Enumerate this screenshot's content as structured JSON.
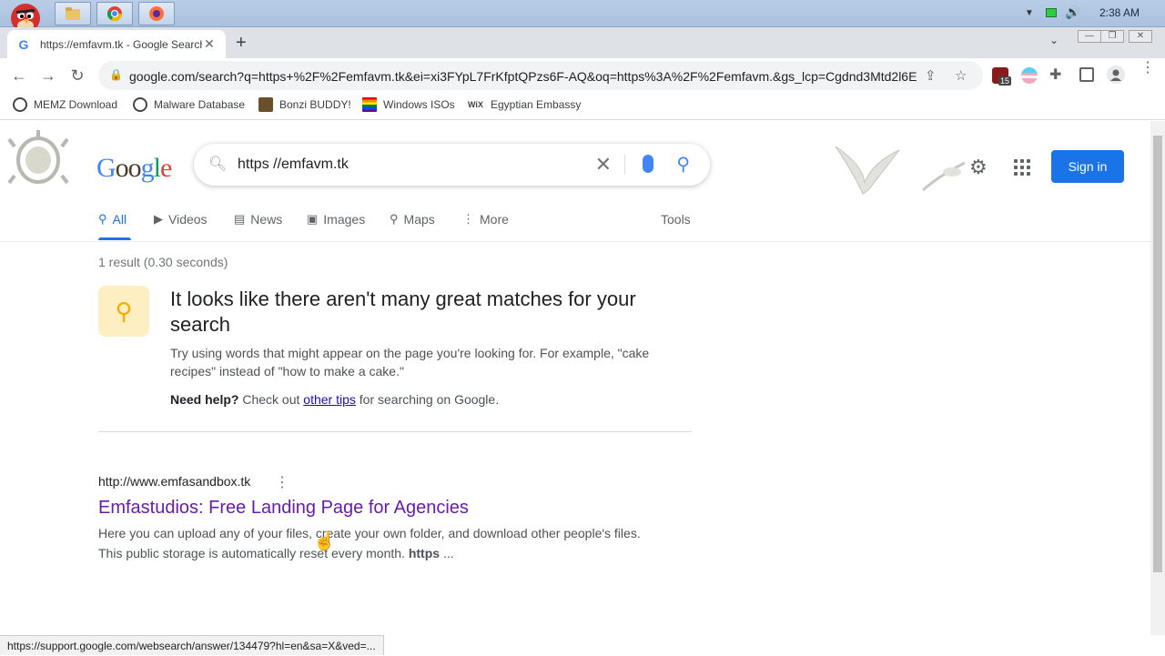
{
  "taskbar": {
    "time": "2:38 AM",
    "apps": [
      "angry-birds-icon",
      "folder-icon",
      "chrome-icon",
      "firefox-icon"
    ]
  },
  "browser": {
    "tab_title": "https://emfavm.tk - Google Search",
    "tab_close": "✕",
    "new_tab": "+",
    "url": "google.com/search?q=https+%2F%2Femfavm.tk&ei=xi3FYpL7FrKfptQPzs6F-AQ&oq=https%3A%2F%2Femfavm.&gs_lcp=Cgdnd3Mtd2l6E...",
    "extension_badge": "15",
    "bookmarks": [
      {
        "label": "MEMZ Download"
      },
      {
        "label": "Malware Database"
      },
      {
        "label": "Bonzi BUDDY!"
      },
      {
        "label": "Windows ISOs"
      },
      {
        "label": "Egyptian Embassy"
      }
    ]
  },
  "google": {
    "logo_text": "Google",
    "query": "https //emfavm.tk",
    "sign_in": "Sign in",
    "tabs": [
      {
        "label": "All"
      },
      {
        "label": "Videos"
      },
      {
        "label": "News"
      },
      {
        "label": "Images"
      },
      {
        "label": "Maps"
      },
      {
        "label": "More"
      }
    ],
    "tools": "Tools",
    "result_stats": "1 result (0.30 seconds)",
    "no_match": {
      "title": "It looks like there aren't many great matches for your search",
      "tip": "Try using words that might appear on the page you're looking for. For example, \"cake recipes\" instead of \"how to make a cake.\"",
      "help_bold": "Need help?",
      "help_pre": "Check out",
      "help_link": "other tips",
      "help_post": "for searching on Google."
    },
    "result": {
      "url": "http://www.emfasandbox.tk",
      "title": "Emfastudios: Free Landing Page for Agencies",
      "snippet": "Here you can upload any of your files, create your own folder, and download other people's files. This public storage is automatically reset every month.",
      "snippet_bold": "https",
      "snippet_end": "..."
    }
  },
  "status_url": "https://support.google.com/websearch/answer/134479?hl=en&sa=X&ved=...",
  "colors": {
    "accent": "#1a73e8",
    "visited_link": "#681da8",
    "link": "#1a0dab"
  }
}
